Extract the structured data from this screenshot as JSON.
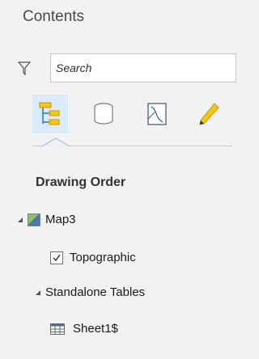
{
  "pane": {
    "title": "Contents"
  },
  "search": {
    "placeholder": "Search"
  },
  "views": [
    {
      "icon": "drawing-order-icon",
      "active": true
    },
    {
      "icon": "data-source-icon",
      "active": false
    },
    {
      "icon": "selection-icon",
      "active": false
    },
    {
      "icon": "editing-icon",
      "active": false
    }
  ],
  "section": {
    "heading": "Drawing Order"
  },
  "tree": {
    "map": {
      "label": "Map3",
      "expanded": true
    },
    "layer": {
      "label": "Topographic",
      "checked": true
    },
    "group": {
      "label": "Standalone Tables",
      "expanded": true
    },
    "table": {
      "label": "Sheet1$"
    }
  },
  "colors": {
    "accent": "#1b7ed6",
    "active_bg": "#dcebfa",
    "icon_yellow": "#f5c518"
  }
}
